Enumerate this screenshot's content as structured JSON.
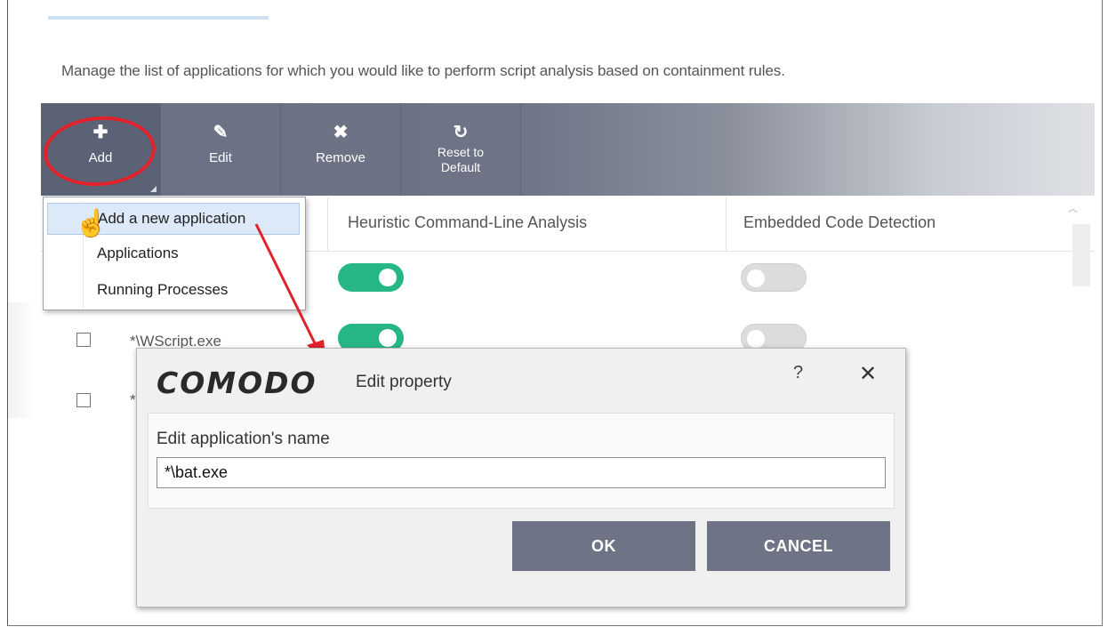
{
  "description": "Manage the list of applications for which you would like to perform script analysis based on containment rules.",
  "toolbar": {
    "add_label": "Add",
    "edit_label": "Edit",
    "remove_label": "Remove",
    "reset_label_line1": "Reset to",
    "reset_label_line2": "Default"
  },
  "add_menu": {
    "items": [
      "Add a new application",
      "Applications",
      "Running Processes"
    ]
  },
  "table": {
    "columns": [
      "Heuristic Command-Line Analysis",
      "Embedded Code Detection"
    ],
    "rows": [
      {
        "name": "",
        "checked": false,
        "heuristic": true,
        "embedded": false
      },
      {
        "name": "*\\WScript.exe",
        "checked": false,
        "heuristic": true,
        "embedded": false
      },
      {
        "name": "*\\",
        "checked": false
      }
    ]
  },
  "dialog": {
    "logo": "COMODO",
    "title": "Edit property",
    "help": "?",
    "close": "✕",
    "field_label": "Edit application's name",
    "field_value": "*\\bat.exe",
    "ok_label": "OK",
    "cancel_label": "CANCEL"
  },
  "colors": {
    "toolbar": "#6e7486",
    "toggle_on": "#27b685",
    "toggle_off": "#dcdcdc",
    "annotation_red": "#e2222b",
    "dialog_button": "#6e7385"
  },
  "icons": {
    "add": "plus-icon",
    "edit": "pencil-icon",
    "remove": "x-icon",
    "reset": "refresh-icon",
    "cursor": "hand-pointer-icon"
  }
}
